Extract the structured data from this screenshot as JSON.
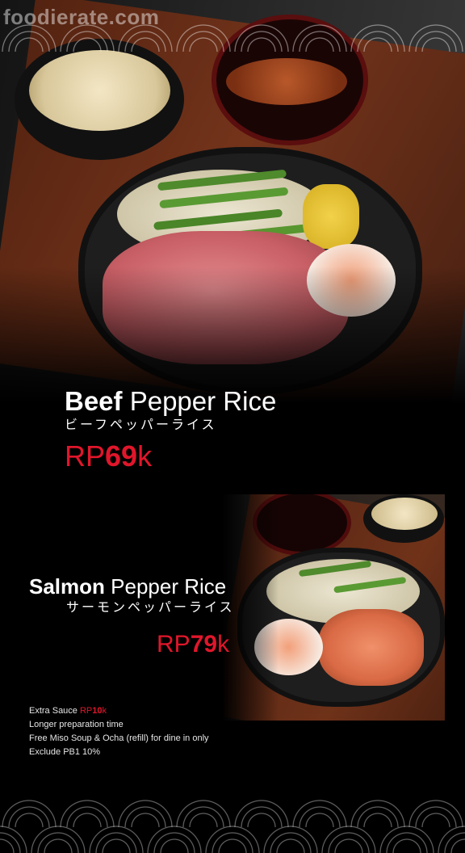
{
  "watermark": "foodierate.com",
  "beef": {
    "name_bold": "Beef",
    "name_rest": "Pepper Rice",
    "name_jp": "ビーフペッパーライス",
    "price_currency": "RP",
    "price_number": "69",
    "price_suffix": "k"
  },
  "salmon": {
    "name_bold": "Salmon",
    "name_rest": "Pepper Rice",
    "name_jp": "サーモンペッパーライス",
    "price_currency": "RP",
    "price_number": "79",
    "price_suffix": "k"
  },
  "notes": {
    "extra_sauce_label": "Extra Sauce",
    "extra_sauce_price_cur": "RP",
    "extra_sauce_price_num": "10",
    "extra_sauce_price_suffix": "k",
    "line2": "Longer preparation time",
    "line3": "Free Miso Soup & Ocha (refill) for dine in only",
    "line4": "Exclude PB1 10%"
  },
  "colors": {
    "background": "#000000",
    "accent": "#e0162b",
    "text": "#ffffff"
  }
}
